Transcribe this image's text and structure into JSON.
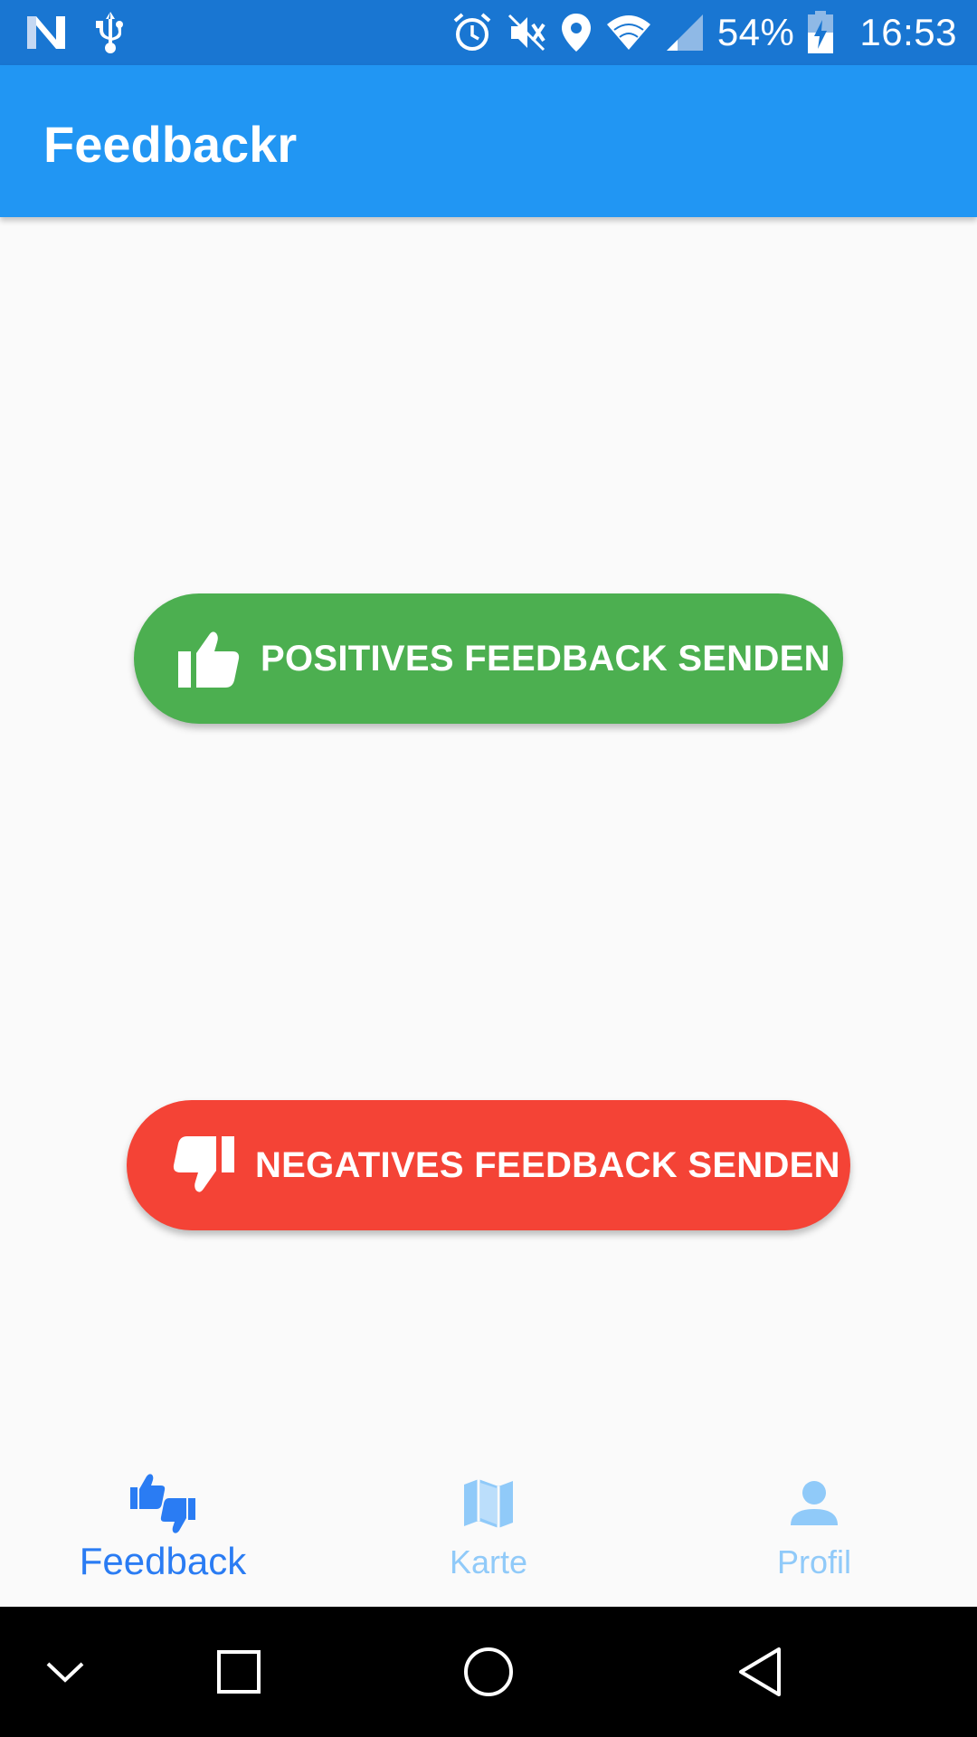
{
  "status_bar": {
    "battery_percent": "54%",
    "time": "16:53",
    "icons": [
      "n-logo-icon",
      "usb-icon",
      "alarm-icon",
      "mute-icon",
      "location-icon",
      "wifi-icon",
      "signal-icon",
      "battery-charging-icon"
    ]
  },
  "app_bar": {
    "title": "Feedbackr"
  },
  "buttons": {
    "positive": {
      "label": "POSITIVES FEEDBACK SENDEN",
      "icon": "thumb-up-icon",
      "color": "#4caf50"
    },
    "negative": {
      "label": "NEGATIVES FEEDBACK SENDEN",
      "icon": "thumb-down-icon",
      "color": "#f44336"
    }
  },
  "bottom_nav": {
    "items": [
      {
        "label": "Feedback",
        "icon": "thumbs-up-down-icon",
        "active": true
      },
      {
        "label": "Karte",
        "icon": "map-icon",
        "active": false
      },
      {
        "label": "Profil",
        "icon": "person-icon",
        "active": false
      }
    ],
    "active_color": "#2a7cf3",
    "inactive_color": "#90caf9"
  },
  "system_nav": {
    "icons": [
      "chevron-down-icon",
      "recents-icon",
      "home-icon",
      "back-icon"
    ]
  },
  "colors": {
    "status_bar": "#1976d2",
    "app_bar": "#2196f3",
    "background": "#fafafa"
  }
}
